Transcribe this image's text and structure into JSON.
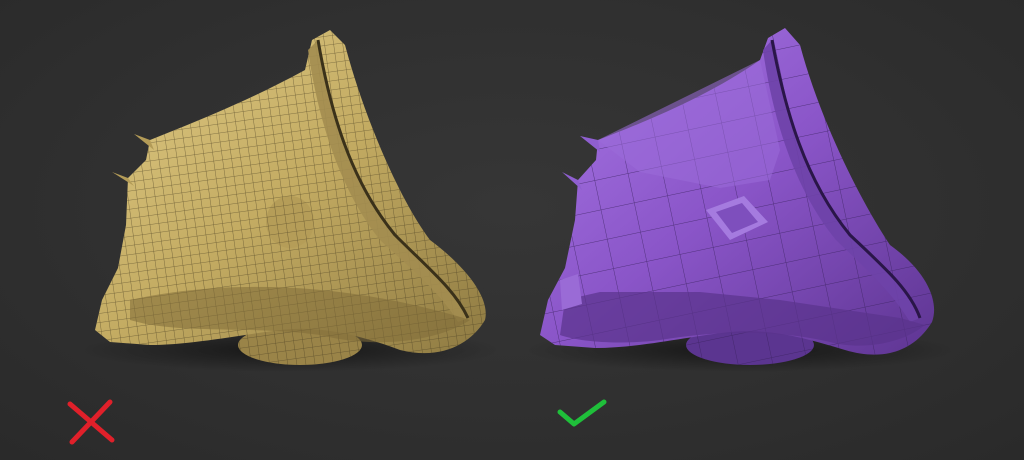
{
  "scene": {
    "background": "#2f2f2f",
    "models": [
      {
        "name": "dense-mesh-model",
        "color": "#c7b16b",
        "wire_color": "#4a3f22",
        "verdict": "wrong",
        "verdict_icon": "red-x-icon",
        "verdict_color": "#e0202a"
      },
      {
        "name": "clean-topology-model",
        "color": "#8a55c8",
        "wire_color": "#3a2260",
        "verdict": "correct",
        "verdict_icon": "green-check-icon",
        "verdict_color": "#1fbf3a"
      }
    ]
  }
}
